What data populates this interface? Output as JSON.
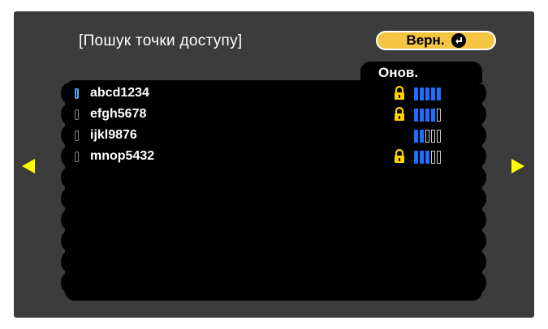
{
  "header": {
    "title": "[Пошук точки доступу]",
    "back_label": "Верн."
  },
  "list": {
    "refresh_label": "Онов.",
    "items": [
      {
        "ssid": "abcd1234",
        "locked": true,
        "signal": 5,
        "selected": true
      },
      {
        "ssid": "efgh5678",
        "locked": true,
        "signal": 4,
        "selected": false
      },
      {
        "ssid": "ijkl9876",
        "locked": false,
        "signal": 2,
        "selected": false
      },
      {
        "ssid": "mnop5432",
        "locked": true,
        "signal": 3,
        "selected": false
      }
    ]
  },
  "colors": {
    "accent": "#f5c542",
    "signal_on": "#1e6fff",
    "arrow": "#ffff00",
    "lock": "#ffd400"
  },
  "icons": {
    "back": "enter-icon",
    "lock": "lock-icon",
    "signal": "signal-strength-icon",
    "prev": "arrow-left-icon",
    "next": "arrow-right-icon"
  }
}
